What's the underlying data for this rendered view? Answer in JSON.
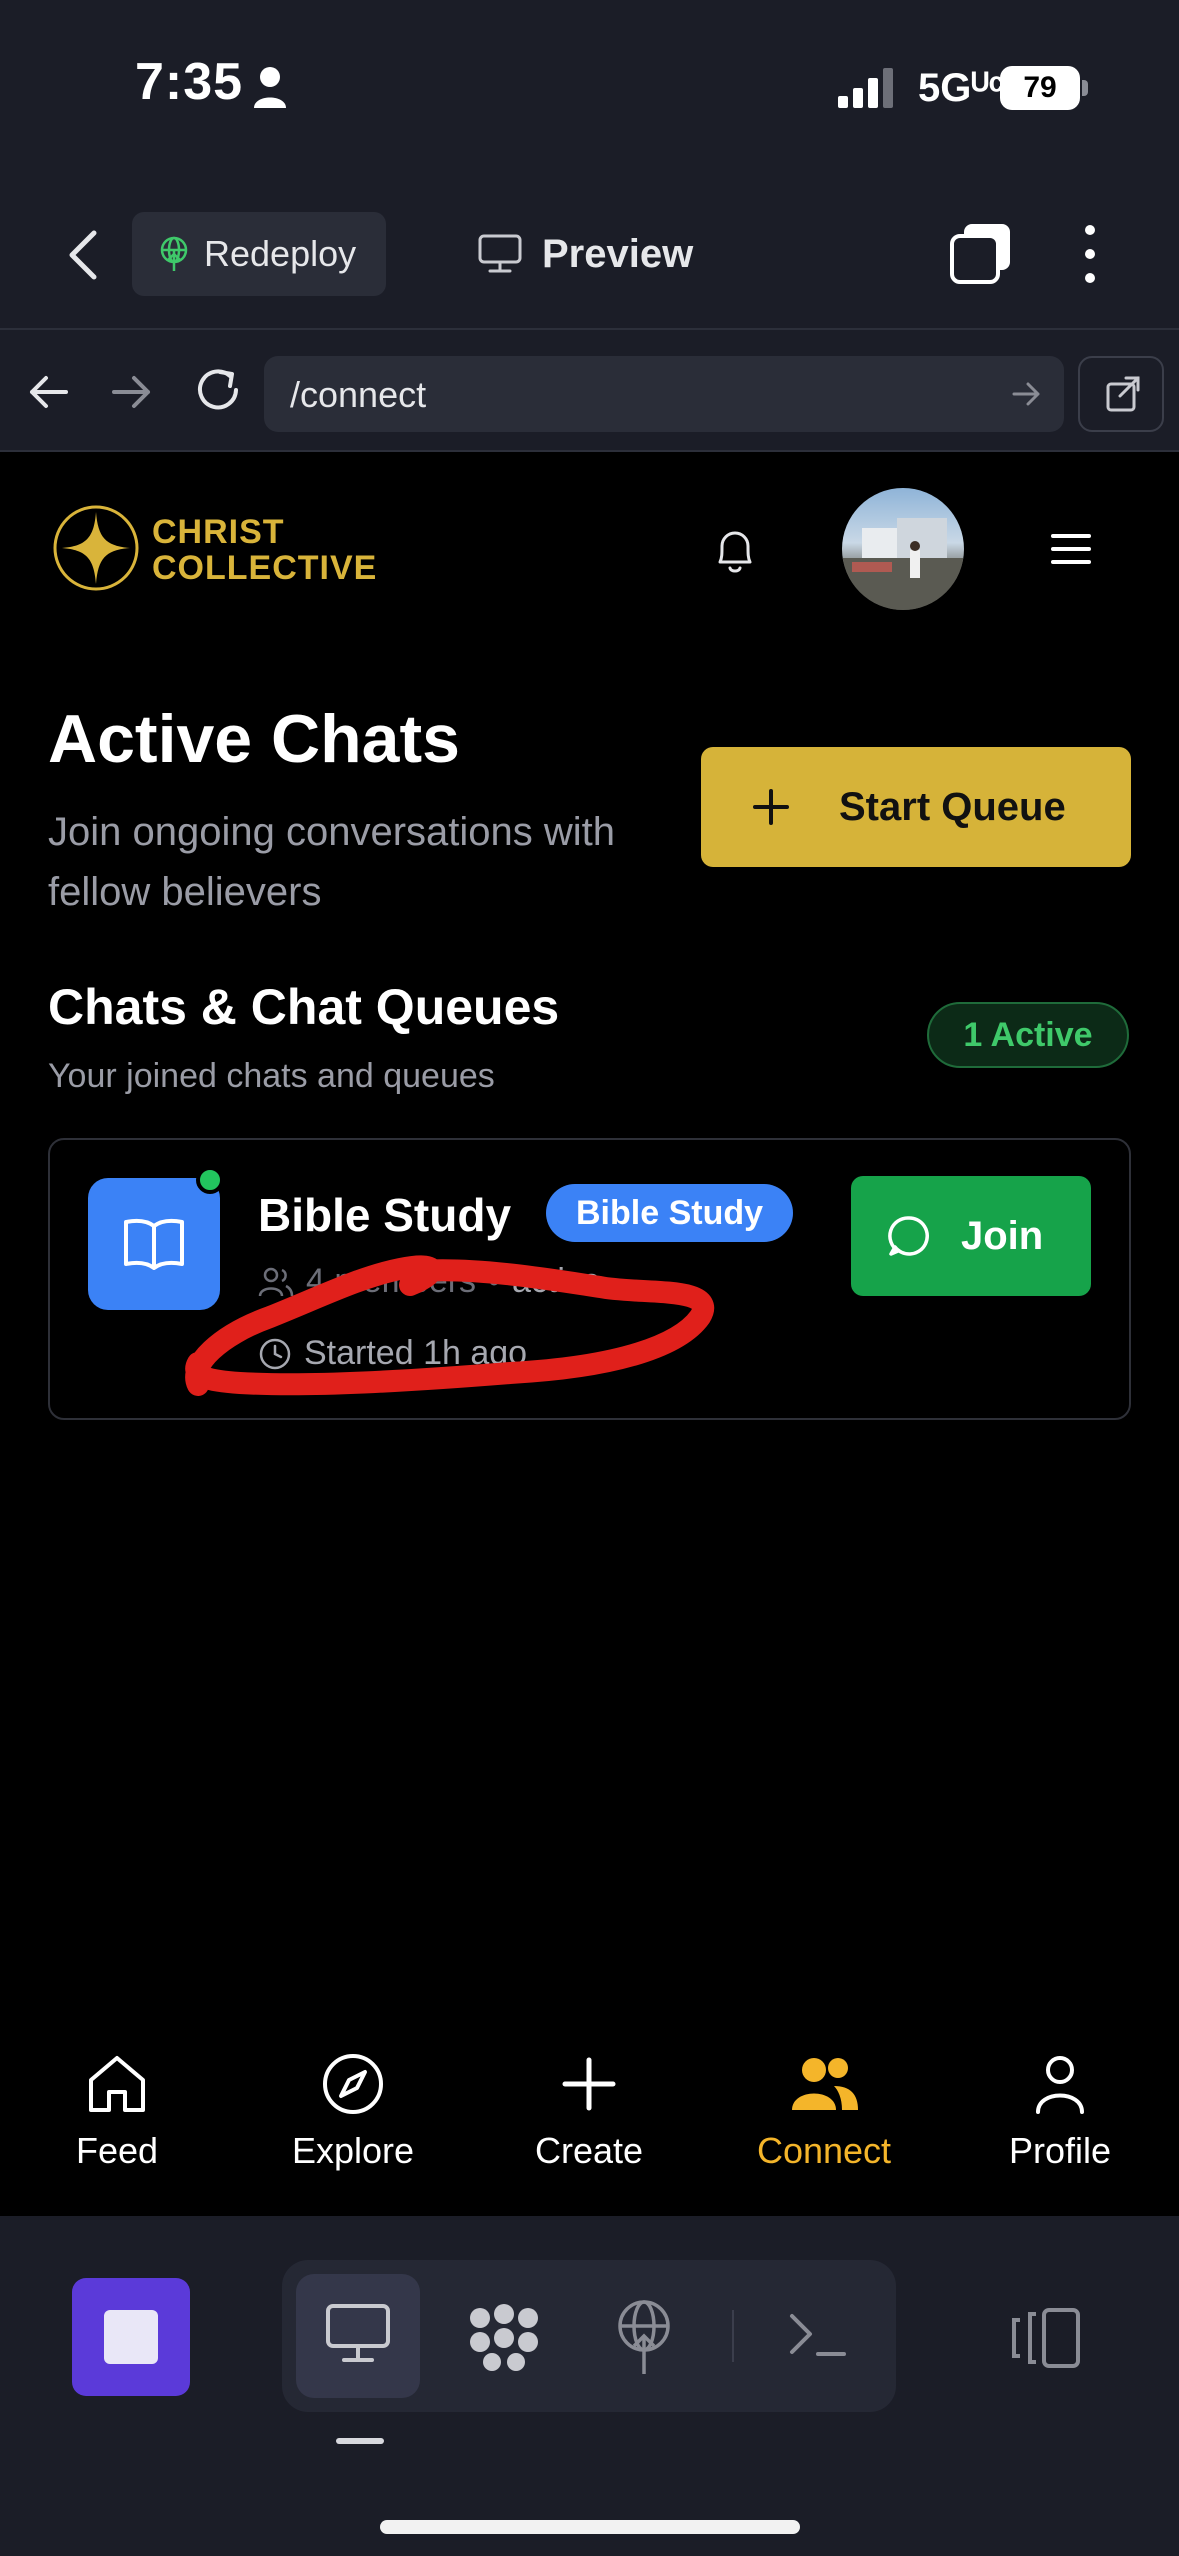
{
  "status_bar": {
    "time": "7:35",
    "network": "5Gᵁᶜ",
    "battery": "79"
  },
  "app_toolbar": {
    "redeploy_label": "Redeploy",
    "preview_label": "Preview"
  },
  "browser": {
    "url": "/connect"
  },
  "site": {
    "brand_line1": "CHRIST",
    "brand_line2": "COLLECTIVE",
    "brand_color": "#d9b43a"
  },
  "page": {
    "title": "Active Chats",
    "subtitle": "Join ongoing conversations with fellow believers",
    "start_queue_label": "Start Queue"
  },
  "section": {
    "title": "Chats & Chat Queues",
    "subtitle": "Your joined chats and queues",
    "active_badge": "1 Active"
  },
  "chats": [
    {
      "name": "Bible Study",
      "tag": "Bible Study",
      "members": "4 members",
      "separator": "•",
      "status": "active",
      "started": "Started 1h ago",
      "join_label": "Join"
    }
  ],
  "site_nav": [
    {
      "label": "Feed",
      "icon": "home-icon"
    },
    {
      "label": "Explore",
      "icon": "compass-icon"
    },
    {
      "label": "Create",
      "icon": "plus-icon"
    },
    {
      "label": "Connect",
      "icon": "users-icon",
      "active": true
    },
    {
      "label": "Profile",
      "icon": "user-icon"
    }
  ],
  "colors": {
    "accent_gold": "#d6b339",
    "nav_active": "#f4b52a",
    "join_green": "#16a34a",
    "tag_blue": "#3b82f6",
    "annotation_red": "#e0201b"
  }
}
